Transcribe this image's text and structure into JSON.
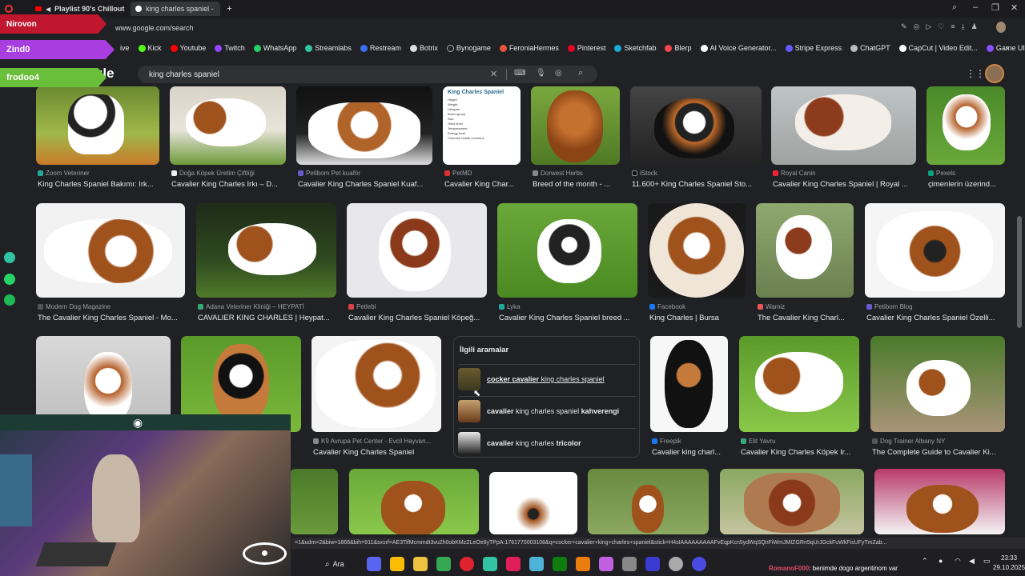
{
  "browser": {
    "tabs": [
      {
        "label": "Playlist 90's Chillout",
        "active": false
      },
      {
        "label": "king charles spaniel - Goo",
        "active": true
      }
    ],
    "url": "www.google.com/search",
    "bookmarks": [
      "ive",
      "Kick",
      "Youtube",
      "Twitch",
      "WhatsApp",
      "Streamlabs",
      "Restream",
      "Botrix",
      "Bynogame",
      "FeroniaHermes",
      "Pinterest",
      "Sketchfab",
      "Blerp",
      "AI Voice Generator...",
      "Stripe Express",
      "ChatGPT",
      "CapCut | Video Edit...",
      "Game UI Database -..."
    ]
  },
  "google": {
    "logo_partial": "gle",
    "query": "king charles spaniel"
  },
  "results": [
    {
      "source": "Zoom Veteriner",
      "title": "King Charles Spaniel Bakımı: Irk..."
    },
    {
      "source": "Doğa Köpek Üretim Çiftliği",
      "title": "Cavalier King Charles Irkı – D..."
    },
    {
      "source": "Petibom Pet kuaför",
      "title": "Cavalier King Charles Spaniel Kuaf..."
    },
    {
      "source": "PetMD",
      "title": "Cavalier King Char..."
    },
    {
      "source": "Dorwest Herbs",
      "title": "Breed of the month - ..."
    },
    {
      "source": "iStock",
      "title": "11.600+ King Charles Spaniel Sto..."
    },
    {
      "source": "Royal Canin",
      "title": "Cavalier King Charles Spaniel | Royal ..."
    },
    {
      "source": "Pexels",
      "title": "çimenlerin üzerind..."
    },
    {
      "source": "Modern Dog Magazine",
      "title": "The Cavalier King Charles Spaniel - Mo..."
    },
    {
      "source": "Adana Veteriner Kliniği – HEYPATİ",
      "title": "CAVALIER KING CHARLES | Heypat..."
    },
    {
      "source": "Petlebi",
      "title": "Cavalier King Charles Spaniel Köpeğ..."
    },
    {
      "source": "Lyka",
      "title": "Cavalier King Charles Spaniel breed ..."
    },
    {
      "source": "Facebook",
      "title": "King Charles | Bursa"
    },
    {
      "source": "Wamiz",
      "title": "The Cavalier King Charl..."
    },
    {
      "source": "Petibom Blog",
      "title": "Cavalier King Charles Spaniel Özelli..."
    },
    {
      "source": "K9 Avrupa Pet Center - Evcil Hayvan...",
      "title": "Cavalier King Charles Spaniel"
    },
    {
      "source": "Freepik",
      "title": "Cavalier king charl..."
    },
    {
      "source": "Elit Yavru",
      "title": "Cavalier King Charles Köpek Ir..."
    },
    {
      "source": "Dog Trainer Albany NY",
      "title": "The Complete Guide to Cavalier Ki..."
    }
  ],
  "petmd_table": {
    "heading": "King Charles Spaniel",
    "rows": [
      "Height",
      "Weight",
      "Lifespan",
      "Breed group",
      "Size",
      "Shed level",
      "Temperament",
      "Energy level",
      "Common health concerns"
    ]
  },
  "related": {
    "heading": "İlgili aramalar",
    "items": [
      {
        "bold1": "cocker cavalier",
        "rest": "king charles spaniel",
        "bold2": ""
      },
      {
        "bold1": "cavalier",
        "rest": "king charles spaniel",
        "bold2": "kahverengi"
      },
      {
        "bold1": "cavalier",
        "rest": "king charles",
        "bold2": "tricolor"
      }
    ]
  },
  "overlays": [
    "Nirovon",
    "Zind0",
    "frodoo4"
  ],
  "status_url": "=1&udm=2&biw=1866&bih=911&sxsrf=AE3TifMcmmdt3vu2h0obKMzZLeOe9yTPpA:1761770003108&q=cocker+cavalier+king+charles+spaniel&stick=H4sIAAAAAAAAAFvEqpKcn5ydWqSQnFiWmJMIZGRn5qUrJGckFuWkFisUFyTmZab...",
  "taskbar": {
    "search_label": "Ara",
    "time": "23:33",
    "date": "29.10.2025"
  },
  "chat": {
    "user": "RomanoF000",
    "message": ": benimde dogo argentinom var"
  }
}
